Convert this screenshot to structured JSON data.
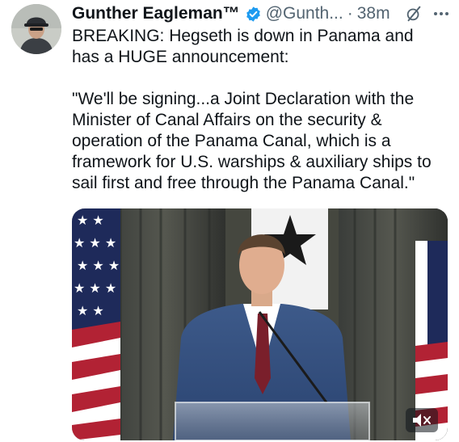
{
  "author": {
    "display_name": "Gunther Eagleman™",
    "handle": "@Gunth...",
    "separator": "·",
    "timestamp": "38m"
  },
  "tweet": {
    "lines": [
      "BREAKING: Hegseth is down in Panama and",
      "has a HUGE announcement:",
      "",
      "\"We'll be signing...a Joint Declaration with the",
      "Minister of Canal Affairs on the security &",
      "operation of the Panama Canal, which is a",
      "framework for U.S. warships & auxiliary ships to",
      "sail first and free through the Panama Canal.\""
    ]
  },
  "icons": {
    "verified": "verified-badge-icon",
    "grok": "grok-icon",
    "more": "more-options-icon",
    "mute": "muted-speaker-icon"
  },
  "colors": {
    "verified": "#1d9bf0",
    "secondary_text": "#536471",
    "primary_text": "#0f1419"
  }
}
